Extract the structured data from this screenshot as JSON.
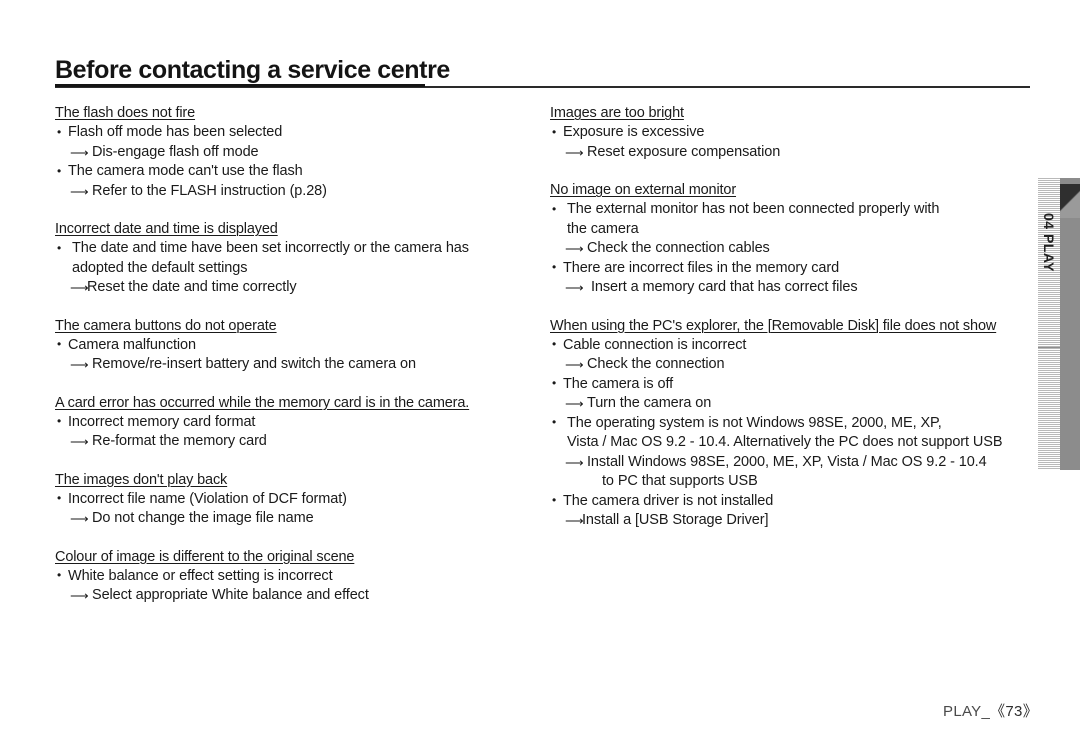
{
  "page": {
    "heading": "Before contacting a service centre",
    "footer_label": "PLAY_",
    "footer_page": "《73》",
    "side_tab_label": "04 PLAY"
  },
  "left_column": [
    {
      "title": "The flash does not fire",
      "items": [
        {
          "cause": "Flash off mode has been selected",
          "fix": "Dis-engage flash off mode"
        },
        {
          "cause": "The camera mode can't use the flash",
          "fix": "Refer to the FLASH instruction (p.28)"
        }
      ]
    },
    {
      "title": "Incorrect date and time is displayed",
      "items": [
        {
          "cause": "The date and time have been set incorrectly or the camera has",
          "cause_cont": "adopted the default settings",
          "fix": "Reset the date and time correctly",
          "fix_style": "tight",
          "cause_style": "gap"
        }
      ]
    },
    {
      "title": "The camera buttons do not operate",
      "items": [
        {
          "cause": "Camera malfunction",
          "fix": "Remove/re-insert battery and switch the camera on"
        }
      ]
    },
    {
      "title": "A card error has occurred while the memory card is in the camera.",
      "items": [
        {
          "cause": "Incorrect memory card format",
          "fix": "Re-format the memory card"
        }
      ]
    },
    {
      "title": "The images don't play back",
      "items": [
        {
          "cause": "Incorrect file name (Violation of DCF format)",
          "fix": "Do not change the image file name"
        }
      ]
    },
    {
      "title": "Colour of image is different to the original scene",
      "items": [
        {
          "cause": "White balance or effect setting is incorrect",
          "fix": "Select appropriate White balance and effect"
        }
      ]
    }
  ],
  "right_column": [
    {
      "title": "Images are too bright",
      "items": [
        {
          "cause": "Exposure is excessive",
          "fix": "Reset exposure compensation"
        }
      ]
    },
    {
      "title": "No image on external monitor",
      "items": [
        {
          "cause": "The external monitor has not been connected properly with",
          "cause_cont": "the camera",
          "cause_style": "gap",
          "fix": "Check the connection cables"
        },
        {
          "cause": "There are incorrect files in the memory card",
          "fix": "Insert a memory card that has correct files",
          "fix_style": "wide"
        }
      ]
    },
    {
      "title": "When using the PC's explorer, the [Removable Disk] file does not show",
      "items": [
        {
          "cause": "Cable connection is incorrect",
          "fix": "Check the connection"
        },
        {
          "cause": "The camera is off",
          "fix": "Turn the camera on"
        },
        {
          "cause": "The operating system is not Windows 98SE, 2000, ME, XP,",
          "cause_cont": "Vista / Mac OS 9.2 - 10.4. Alternatively the PC does not support USB",
          "cause_style": "gap",
          "fix": "Install Windows 98SE, 2000, ME, XP, Vista / Mac OS 9.2 - 10.4",
          "fix_cont": "to PC that supports USB"
        },
        {
          "cause": "The camera driver is not installed",
          "fix": "Install a [USB Storage Driver]",
          "fix_style": "tight"
        }
      ]
    }
  ]
}
